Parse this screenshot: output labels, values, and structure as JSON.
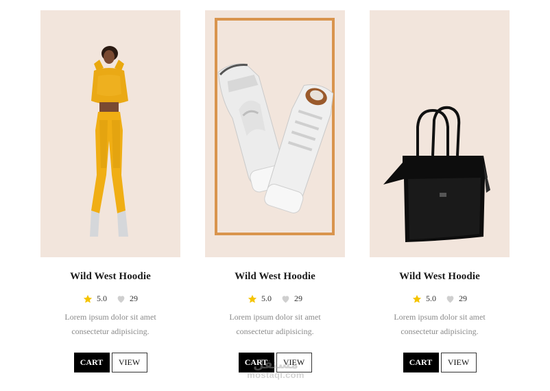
{
  "products": [
    {
      "title": "Wild West Hoodie",
      "rating": "5.0",
      "likes": "29",
      "description_line1": "Lorem ipsum dolor sit amet",
      "description_line2": "consectetur adipisicing.",
      "cart_label": "CART",
      "view_label": "VIEW",
      "image": "woman-in-yellow-tracksuit"
    },
    {
      "title": "Wild West Hoodie",
      "rating": "5.0",
      "likes": "29",
      "description_line1": "Lorem ipsum dolor sit amet",
      "description_line2": "consectetur adipisicing.",
      "cart_label": "CART",
      "view_label": "VIEW",
      "image": "white-high-top-sneakers"
    },
    {
      "title": "Wild West Hoodie",
      "rating": "5.0",
      "likes": "29",
      "description_line1": "Lorem ipsum dolor sit amet",
      "description_line2": "consectetur adipisicing.",
      "cart_label": "CART",
      "view_label": "VIEW",
      "image": "black-leather-tote-bag"
    }
  ],
  "icons": {
    "rating": "star-icon",
    "likes": "heart-icon"
  },
  "colors": {
    "card_bg": "#f2e5dc",
    "star": "#f5c400",
    "heart": "#cfcfcf",
    "frame": "#d9944d",
    "cart_bg": "#000000"
  },
  "watermark": {
    "arabic": "مستقل",
    "latin": "mostaql.com"
  }
}
